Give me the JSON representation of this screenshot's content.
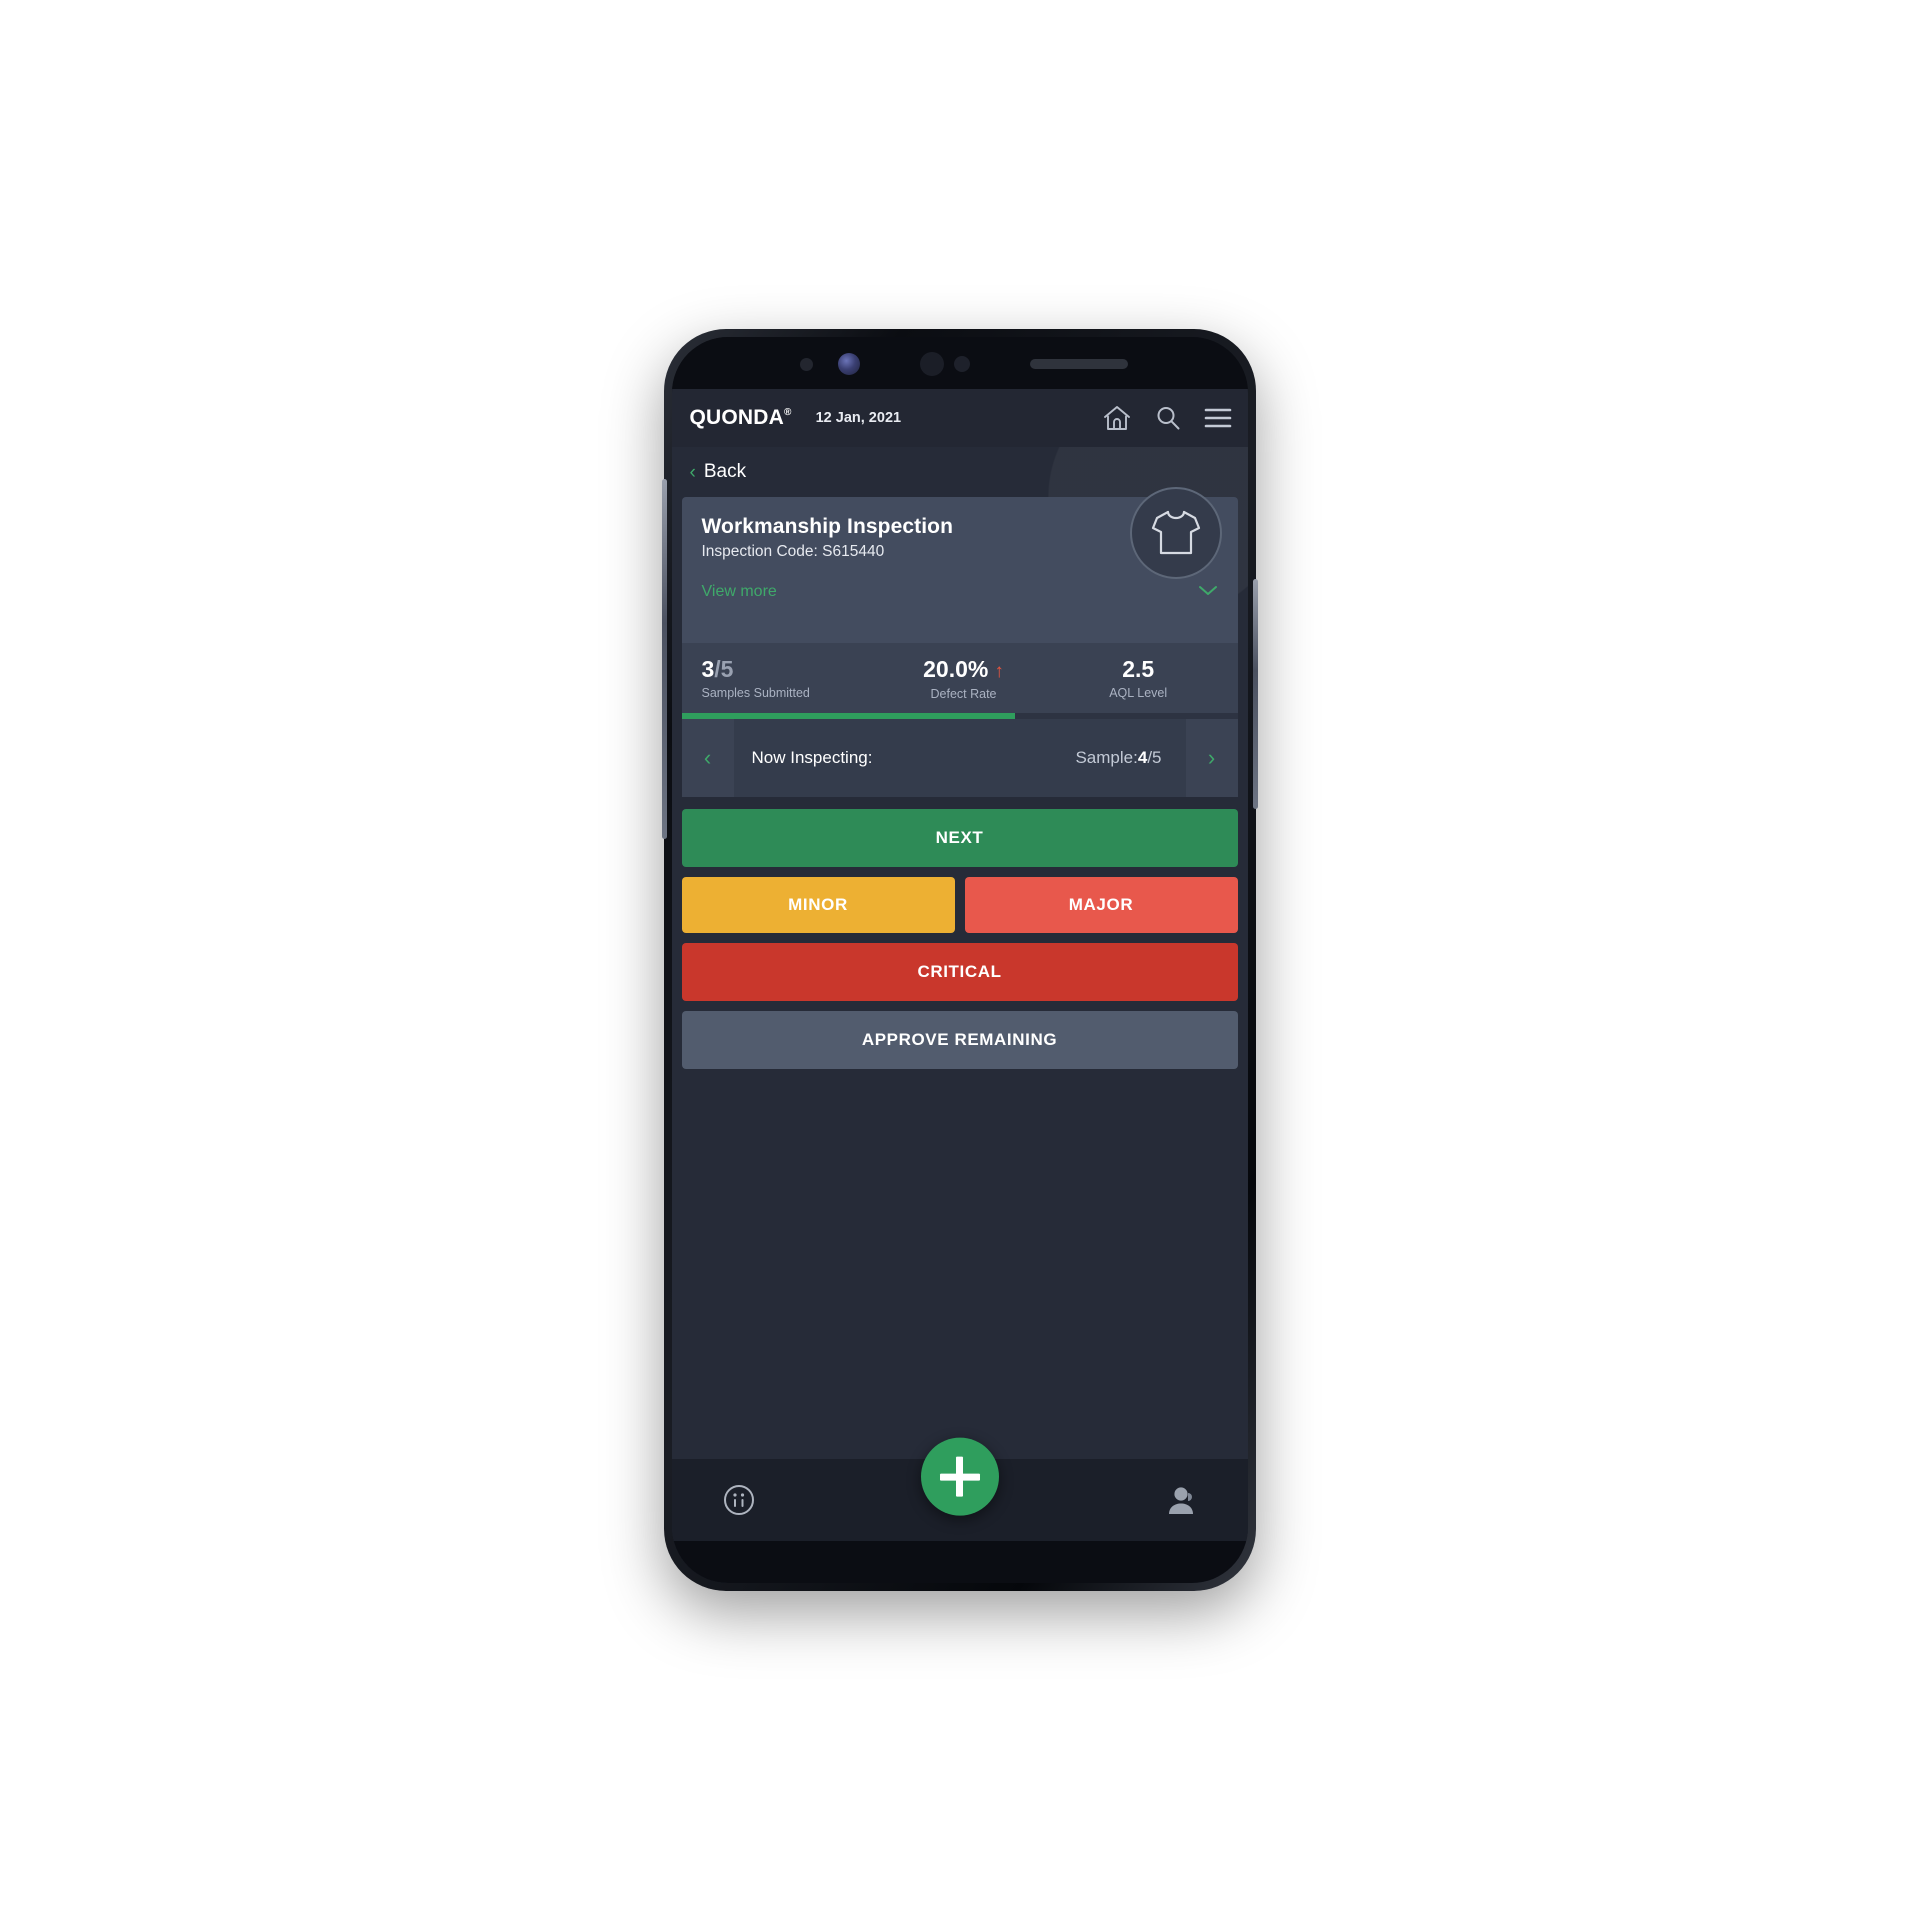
{
  "header": {
    "brand": "QUONDA",
    "brand_mark": "®",
    "date": "12 Jan, 2021",
    "icons": {
      "home": "home-icon",
      "search": "search-icon",
      "menu": "hamburger-menu-icon"
    }
  },
  "nav": {
    "back_chevron": "‹",
    "back_label": "Back"
  },
  "inspection": {
    "title": "Workmanship Inspection",
    "code_label": "Inspection Code: S615440",
    "view_more": "View more",
    "view_more_chevron": "⌄",
    "garment_icon": "tshirt-icon"
  },
  "stats": [
    {
      "value": "3",
      "value_suffix": "/5",
      "label": "Samples Submitted",
      "trend": ""
    },
    {
      "value": "20.0%",
      "value_suffix": "",
      "label": "Defect Rate",
      "trend": "↑"
    },
    {
      "value": "2.5",
      "value_suffix": "",
      "label": "AQL Level",
      "trend": ""
    }
  ],
  "progress": {
    "percent": 60
  },
  "sample_nav": {
    "prev_chevron": "‹",
    "next_chevron": "›",
    "label": "Now Inspecting:",
    "value_prefix": "Sample:",
    "value_current": "4",
    "value_total": "/5"
  },
  "actions": {
    "next": "NEXT",
    "minor": "MINOR",
    "major": "MAJOR",
    "critical": "CRITICAL",
    "approve_remaining": "APPROVE REMAINING"
  },
  "bottom_nav": {
    "info_icon": "info-circle-icon",
    "add_label": "+",
    "support_icon": "support-agent-icon"
  },
  "colors": {
    "accent_green": "#2f9e5d",
    "minor_amber": "#edb033",
    "major_red": "#e8584c",
    "critical_red": "#c9372c",
    "neutral_gray": "#525c6e",
    "app_bg": "#262b38",
    "header_bg": "#232733"
  }
}
